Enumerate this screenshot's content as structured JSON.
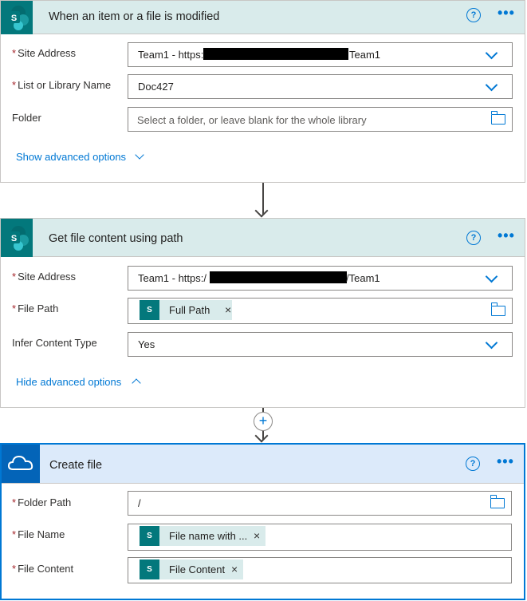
{
  "card1": {
    "title": "When an item or a file is modified",
    "help": "?",
    "more": "•••",
    "site_address": {
      "label": "Site Address",
      "value_prefix": "Team1 - https:",
      "value_suffix": "Team1"
    },
    "list_name": {
      "label": "List or Library Name",
      "value": "Doc427"
    },
    "folder": {
      "label": "Folder",
      "placeholder": "Select a folder, or leave blank for the whole library"
    },
    "advanced_link": "Show advanced options"
  },
  "card2": {
    "title": "Get file content using path",
    "help": "?",
    "more": "•••",
    "site_address": {
      "label": "Site Address",
      "value_prefix": "Team1 - https:/",
      "value_suffix": "/Team1"
    },
    "file_path": {
      "label": "File Path",
      "token": "Full Path"
    },
    "infer_content_type": {
      "label": "Infer Content Type",
      "value": "Yes"
    },
    "advanced_link": "Hide advanced options"
  },
  "connector": {
    "plus": "+"
  },
  "card3": {
    "title": "Create file",
    "help": "?",
    "more": "•••",
    "folder_path": {
      "label": "Folder Path",
      "value": "/"
    },
    "file_name": {
      "label": "File Name",
      "token": "File name with ..."
    },
    "file_content": {
      "label": "File Content",
      "token": "File Content"
    }
  },
  "required_marker": "*",
  "token_icon_text": "S",
  "token_remove": "×",
  "colors": {
    "sharepoint_teal": "#03787c",
    "onedrive_blue": "#0364b8",
    "header_bg": "#d9ebeb",
    "selected_header_bg": "#dceafa",
    "accent": "#0078d4"
  }
}
